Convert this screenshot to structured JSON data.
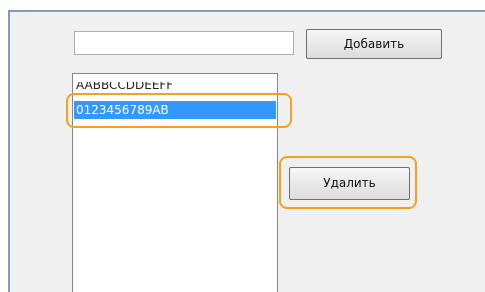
{
  "dialog": {
    "add_input": {
      "value": "",
      "placeholder": ""
    },
    "add_button_label": "Добавить",
    "delete_button_label": "Удалить",
    "list": {
      "items": [
        {
          "label": "AABBCCDDEEFF",
          "selected": false
        },
        {
          "label": "0123456789AB",
          "selected": true
        }
      ]
    }
  },
  "colors": {
    "selection": "#3399ff",
    "highlight": "#f4a21e",
    "panel_background": "#f0f0f0"
  }
}
